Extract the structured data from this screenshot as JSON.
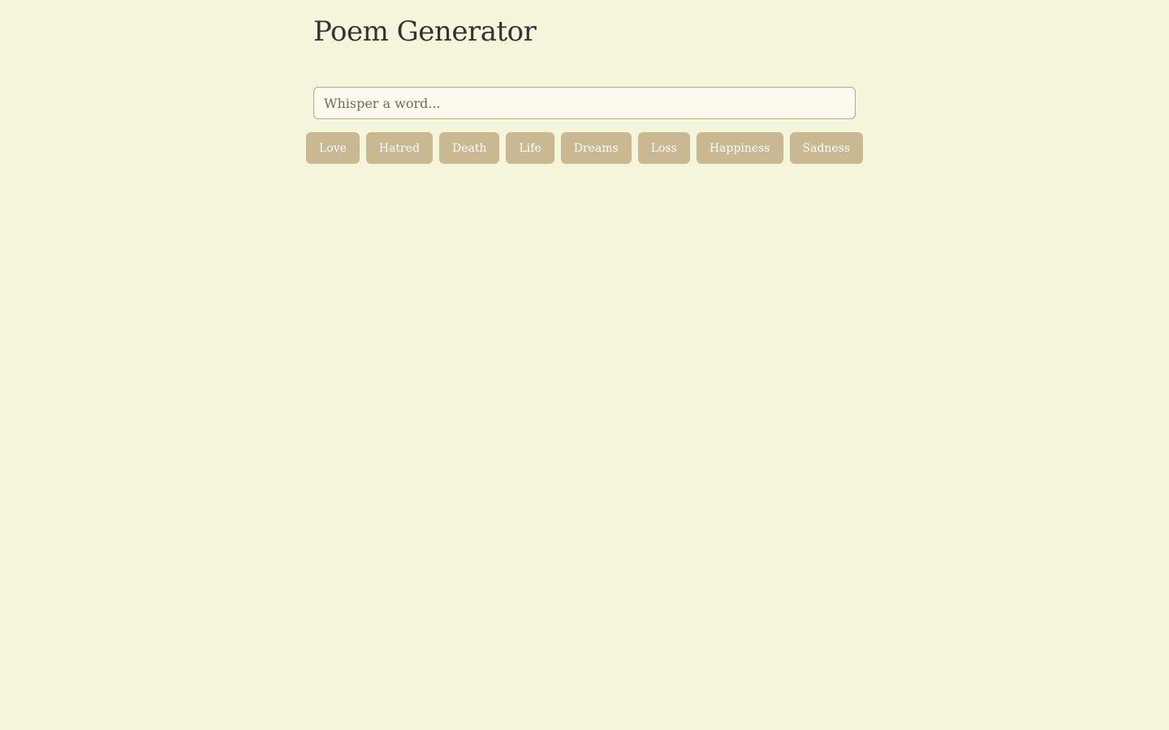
{
  "page": {
    "title": "Poem Generator"
  },
  "search": {
    "placeholder": "Whisper a word...",
    "value": ""
  },
  "tags": [
    "Love",
    "Hatred",
    "Death",
    "Life",
    "Dreams",
    "Loss",
    "Happiness",
    "Sadness"
  ],
  "colors": {
    "background": "#f5f5dc",
    "input_background": "#fdf9ee",
    "tag_background": "#cab893",
    "tag_text": "#ffffff",
    "title_text": "#333333"
  }
}
